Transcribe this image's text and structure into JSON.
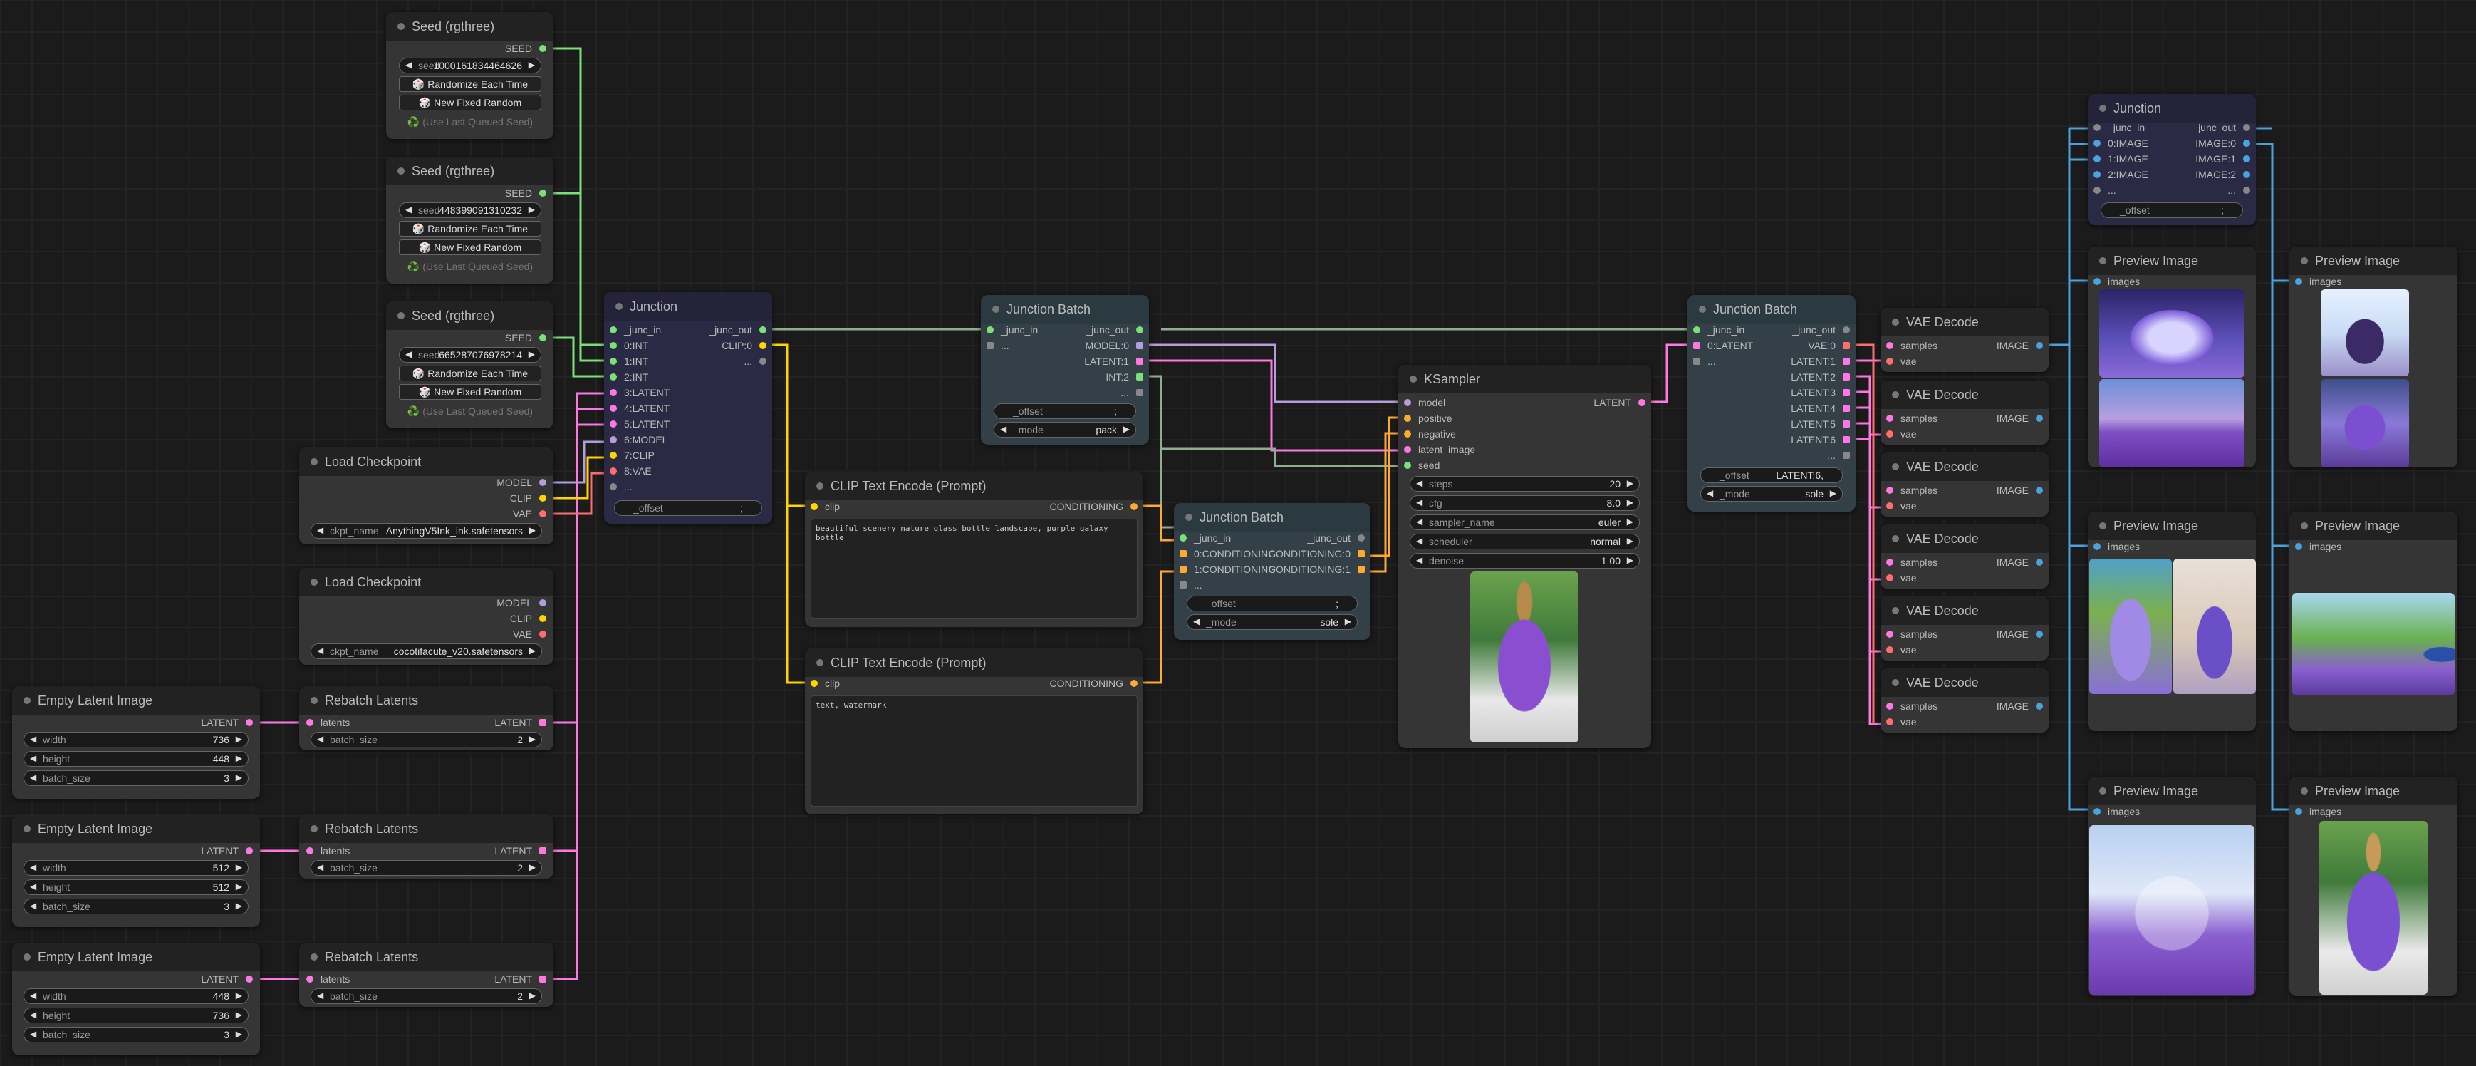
{
  "colors": {
    "image": "#4aa3df",
    "latent": "#ff77e0",
    "int": "#7ae07a",
    "model": "#b39ddb",
    "clip": "#ffd500",
    "vae": "#ff6e6e",
    "conditioning": "#ffa931",
    "junction": "#2b2a45"
  },
  "seed_nodes": [
    {
      "title": "Seed (rgthree)",
      "out": "SEED",
      "seed_label": "seed",
      "seed_value": "1000161834464626",
      "btn_random": "🎲 Randomize Each Time",
      "btn_fixed": "🎲 New Fixed Random",
      "last": "♻️ (Use Last Queued Seed)"
    },
    {
      "title": "Seed (rgthree)",
      "out": "SEED",
      "seed_label": "seed",
      "seed_value": "448399091310232",
      "btn_random": "🎲 Randomize Each Time",
      "btn_fixed": "🎲 New Fixed Random",
      "last": "♻️ (Use Last Queued Seed)"
    },
    {
      "title": "Seed (rgthree)",
      "out": "SEED",
      "seed_label": "seed",
      "seed_value": "665287076978214",
      "btn_random": "🎲 Randomize Each Time",
      "btn_fixed": "🎲 New Fixed Random",
      "last": "♻️ (Use Last Queued Seed)"
    }
  ],
  "checkpoints": [
    {
      "title": "Load Checkpoint",
      "outs": [
        "MODEL",
        "CLIP",
        "VAE"
      ],
      "label": "ckpt_name",
      "value": "AnythingV5Ink_ink.safetensors"
    },
    {
      "title": "Load Checkpoint",
      "outs": [
        "MODEL",
        "CLIP",
        "VAE"
      ],
      "label": "ckpt_name",
      "value": "cocotifacute_v20.safetensors"
    }
  ],
  "empty_latents": [
    {
      "title": "Empty Latent Image",
      "out": "LATENT",
      "width": "736",
      "height": "448",
      "batch_size": "3"
    },
    {
      "title": "Empty Latent Image",
      "out": "LATENT",
      "width": "512",
      "height": "512",
      "batch_size": "3"
    },
    {
      "title": "Empty Latent Image",
      "out": "LATENT",
      "width": "448",
      "height": "736",
      "batch_size": "3"
    }
  ],
  "labels": {
    "width": "width",
    "height": "height",
    "batch_size": "batch_size",
    "latents": "latents",
    "offset": "_offset",
    "mode": "_mode",
    "junc_in": "_junc_in",
    "junc_out": "_junc_out",
    "dots": "...",
    "clip": "clip",
    "conditioning": "CONDITIONING",
    "samples": "samples",
    "vae": "vae",
    "image": "IMAGE",
    "images": "images",
    "latent": "LATENT"
  },
  "rebatch": [
    {
      "title": "Rebatch Latents",
      "batch_size": "2"
    },
    {
      "title": "Rebatch Latents",
      "batch_size": "2"
    },
    {
      "title": "Rebatch Latents",
      "batch_size": "2"
    }
  ],
  "junction1": {
    "title": "Junction",
    "inputs": [
      "0:INT",
      "1:INT",
      "2:INT",
      "3:LATENT",
      "4:LATENT",
      "5:LATENT",
      "6:MODEL",
      "7:CLIP",
      "8:VAE"
    ],
    "out2": "CLIP:0",
    "offset_value": ";"
  },
  "junction_batch1": {
    "title": "Junction Batch",
    "outs": [
      "MODEL:0",
      "LATENT:1",
      "INT:2"
    ],
    "offset_value": ";",
    "mode_value": "pack"
  },
  "clip_encode": [
    {
      "title": "CLIP Text Encode (Prompt)",
      "text": "beautiful scenery nature glass bottle landscape, purple galaxy bottle"
    },
    {
      "title": "CLIP Text Encode (Prompt)",
      "text": "text, watermark"
    }
  ],
  "junction_batch2": {
    "title": "Junction Batch",
    "inputs": [
      "0:CONDITIONING",
      "1:CONDITIONING"
    ],
    "outs": [
      "CONDITIONING:0",
      "CONDITIONING:1"
    ],
    "offset_value": ";",
    "mode_value": "sole"
  },
  "ksampler": {
    "title": "KSampler",
    "inputs": [
      "model",
      "positive",
      "negative",
      "latent_image",
      "seed"
    ],
    "out": "LATENT",
    "widgets": [
      {
        "label": "steps",
        "value": "20"
      },
      {
        "label": "cfg",
        "value": "8.0"
      },
      {
        "label": "sampler_name",
        "value": "euler"
      },
      {
        "label": "scheduler",
        "value": "normal"
      },
      {
        "label": "denoise",
        "value": "1.00"
      }
    ]
  },
  "junction_batch3": {
    "title": "Junction Batch",
    "in1": "0:LATENT",
    "outs": [
      "VAE:0",
      "LATENT:1",
      "LATENT:2",
      "LATENT:3",
      "LATENT:4",
      "LATENT:5",
      "LATENT:6"
    ],
    "offset_value": "LATENT:6,",
    "mode_value": "sole"
  },
  "vae_decode": [
    {
      "title": "VAE Decode"
    },
    {
      "title": "VAE Decode"
    },
    {
      "title": "VAE Decode"
    },
    {
      "title": "VAE Decode"
    },
    {
      "title": "VAE Decode"
    },
    {
      "title": "VAE Decode"
    }
  ],
  "junction2": {
    "title": "Junction",
    "inputs": [
      "0:IMAGE",
      "1:IMAGE",
      "2:IMAGE"
    ],
    "outs": [
      "IMAGE:0",
      "IMAGE:1",
      "IMAGE:2"
    ],
    "offset_value": ";"
  },
  "preview": [
    {
      "title": "Preview Image"
    },
    {
      "title": "Preview Image"
    },
    {
      "title": "Preview Image"
    },
    {
      "title": "Preview Image"
    },
    {
      "title": "Preview Image"
    },
    {
      "title": "Preview Image"
    }
  ]
}
